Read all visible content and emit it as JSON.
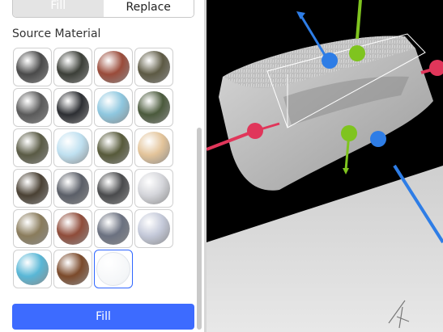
{
  "tabs": {
    "fill_label": "Fill",
    "replace_label": "Replace"
  },
  "panel": {
    "source_label": "Source Material",
    "fill_button_label": "Fill"
  },
  "materials": [
    {
      "name": "asphalt-material-icon",
      "color": "#4a4a4a"
    },
    {
      "name": "basalt-material-icon",
      "color": "#3c3f38"
    },
    {
      "name": "brick-material-icon",
      "color": "#9a4b3a"
    },
    {
      "name": "cobblestone-material-icon",
      "color": "#5d5a44"
    },
    {
      "name": "concrete-material-icon",
      "color": "#5a5a5a"
    },
    {
      "name": "crackedlava-material-icon",
      "color": "#2d2f33"
    },
    {
      "name": "glacier-material-icon",
      "color": "#8ec7df"
    },
    {
      "name": "grass-material-icon",
      "color": "#4b5a3c"
    },
    {
      "name": "ground-material-icon",
      "color": "#5a5b45"
    },
    {
      "name": "ice-material-icon",
      "color": "#bfe0f0"
    },
    {
      "name": "leafygrass-material-icon",
      "color": "#575a3a"
    },
    {
      "name": "limestone-material-icon",
      "color": "#e3c49a"
    },
    {
      "name": "mud-material-icon",
      "color": "#4a4134"
    },
    {
      "name": "pavement-material-icon",
      "color": "#5b5f68"
    },
    {
      "name": "rock-material-icon",
      "color": "#4a4b4d"
    },
    {
      "name": "salt-material-icon",
      "color": "#d4d5da"
    },
    {
      "name": "sand-material-icon",
      "color": "#8a7c5c"
    },
    {
      "name": "sandstone-material-icon",
      "color": "#8f4c3a"
    },
    {
      "name": "slate-material-icon",
      "color": "#6b7180"
    },
    {
      "name": "snow-material-icon",
      "color": "#c4c9d9"
    },
    {
      "name": "water-material-icon",
      "color": "#59b7d6"
    },
    {
      "name": "woodplanks-material-icon",
      "color": "#7b4a2b"
    },
    {
      "name": "air-material-icon",
      "color": "#ffffff"
    }
  ],
  "colors": {
    "accent": "#3d6bff",
    "axis_red": "#e0365a",
    "axis_green": "#7fc41f",
    "axis_blue": "#2e7de6"
  }
}
